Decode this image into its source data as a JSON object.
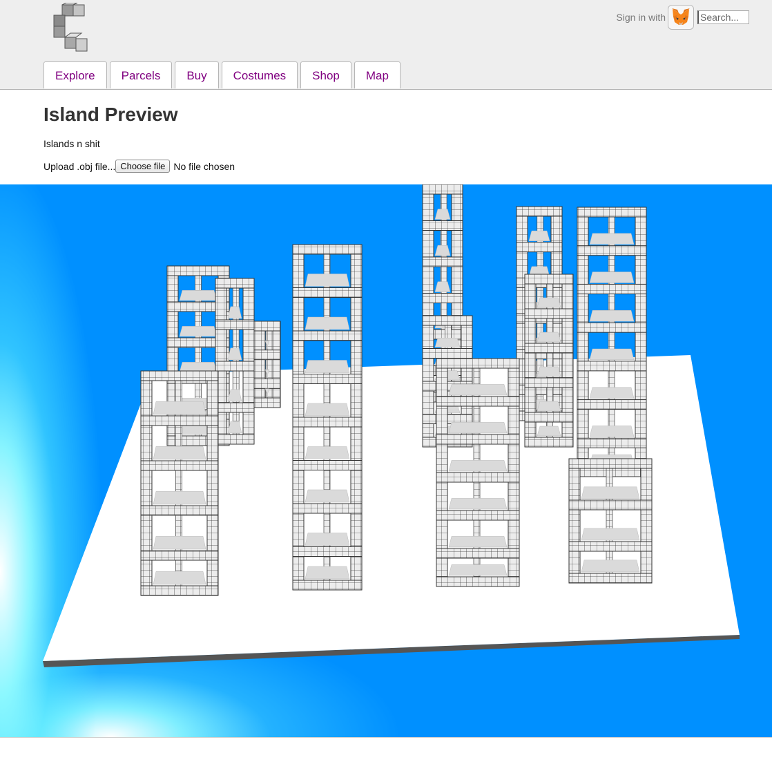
{
  "header": {
    "signin_label": "Sign in with",
    "search_placeholder": "Search...",
    "wallet_icon": "metamask-fox-icon",
    "logo_icon": "cube-c-logo"
  },
  "nav": {
    "tabs": [
      {
        "label": "Explore"
      },
      {
        "label": "Parcels"
      },
      {
        "label": "Buy"
      },
      {
        "label": "Costumes"
      },
      {
        "label": "Shop"
      },
      {
        "label": "Map"
      }
    ]
  },
  "main": {
    "title": "Island Preview",
    "subtitle": "Islands n shit",
    "upload_label": "Upload .obj file...",
    "choose_file_label": "Choose file",
    "file_status": "No file chosen"
  },
  "colors": {
    "tab_text": "#800080",
    "sky": "#0090ff",
    "header_bg": "#eeeeee"
  }
}
